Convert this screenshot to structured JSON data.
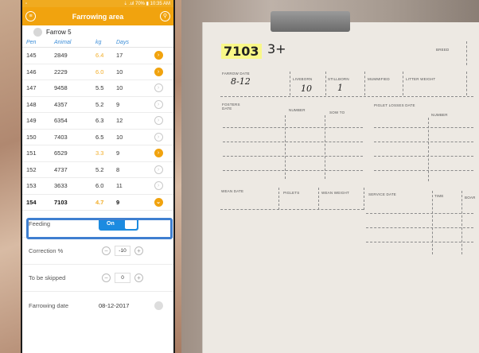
{
  "status_bar": {
    "text": "⇣ .ul 70% ▮ 10:35 AM"
  },
  "app_bar": {
    "title": "Farrowing area"
  },
  "farrow": {
    "label": "Farrow 5"
  },
  "columns": {
    "pen": "Pen",
    "animal": "Animal",
    "kg": "kg",
    "days": "Days"
  },
  "rows": [
    {
      "pen": "145",
      "animal": "2849",
      "kg": "6.4",
      "days": "17",
      "status": "alert"
    },
    {
      "pen": "146",
      "animal": "2229",
      "kg": "6.0",
      "days": "10",
      "status": "alert"
    },
    {
      "pen": "147",
      "animal": "9458",
      "kg": "5.5",
      "days": "10",
      "status": "ok"
    },
    {
      "pen": "148",
      "animal": "4357",
      "kg": "5.2",
      "days": "9",
      "status": "ok"
    },
    {
      "pen": "149",
      "animal": "6354",
      "kg": "6.3",
      "days": "12",
      "status": "ok"
    },
    {
      "pen": "150",
      "animal": "7403",
      "kg": "6.5",
      "days": "10",
      "status": "ok"
    },
    {
      "pen": "151",
      "animal": "6529",
      "kg": "3.3",
      "days": "9",
      "status": "alert"
    },
    {
      "pen": "152",
      "animal": "4737",
      "kg": "5.2",
      "days": "8",
      "status": "ok"
    },
    {
      "pen": "153",
      "animal": "3633",
      "kg": "6.0",
      "days": "11",
      "status": "ok"
    }
  ],
  "selected_row": {
    "pen": "154",
    "animal": "7103",
    "kg": "4.7",
    "days": "9"
  },
  "settings": {
    "feeding_label": "Feeding",
    "feeding_toggle": "On",
    "correction_label": "Correction %",
    "correction_value": "-10",
    "skipped_label": "To be skipped",
    "skipped_value": "0",
    "farrowing_label": "Farrowing date",
    "farrowing_value": "08-12-2017"
  },
  "card": {
    "sow_number": "7103",
    "parity_mark": "3+",
    "labels": {
      "farrow_date": "FARROW DATE",
      "liveborn": "LIVEBORN",
      "stillborn": "STILLBORN",
      "mummified": "MUMMIFIED",
      "litter_weight": "LITTER WEIGHT",
      "breed": "BREED",
      "fosters_date": "FOSTERS DATE",
      "number_1": "NUMBER",
      "sow_to": "SOW TO",
      "piglet_losses_date": "PIGLET LOSSES DATE",
      "number_2": "NUMBER",
      "wean_date": "WEAN DATE",
      "piglets": "PIGLETS",
      "wean_weight": "WEAN WEIGHT",
      "service_date": "SERVICE DATE",
      "time": "TIME",
      "boar": "BOAR"
    },
    "hand_farrow_date": "8-12",
    "hand_liveborn": "10",
    "hand_stillborn": "1"
  },
  "colors": {
    "accent": "#f1a30e",
    "toggle": "#1c8be0",
    "selection": "#3f7fd0",
    "warn_kg": "#f2ae2a"
  },
  "icons": {
    "menu": "circle-menu-icon",
    "search": "circle-search-icon",
    "row_arrow": "chevron-right-circle-icon",
    "row_expand": "chevron-down-circle-icon"
  }
}
